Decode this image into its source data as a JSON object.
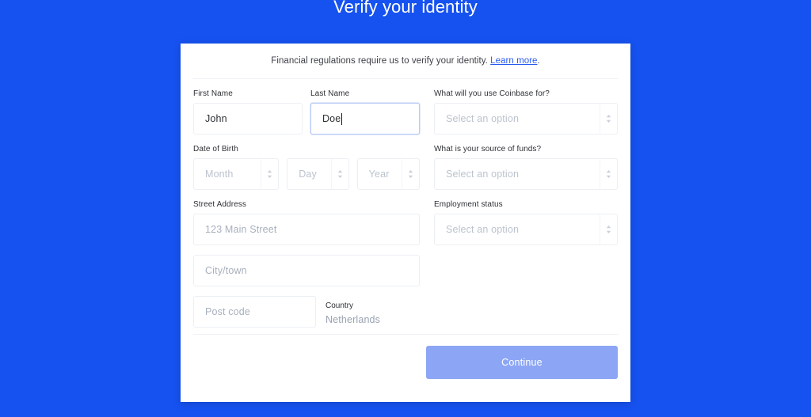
{
  "page": {
    "title": "Verify your identity",
    "background_color": "#1652f0"
  },
  "card": {
    "intro_text": "Financial regulations require us to verify your identity.",
    "intro_link_label": "Learn more",
    "intro_trailing": "."
  },
  "form": {
    "first_name": {
      "label": "First Name",
      "value": "John",
      "placeholder": ""
    },
    "last_name": {
      "label": "Last Name",
      "value": "Doe",
      "placeholder": "",
      "focused": true
    },
    "date_of_birth": {
      "label": "Date of Birth",
      "month_placeholder": "Month",
      "day_placeholder": "Day",
      "year_placeholder": "Year"
    },
    "street_address": {
      "label": "Street Address",
      "placeholder": "123 Main Street",
      "value": ""
    },
    "city": {
      "placeholder": "City/town",
      "value": ""
    },
    "post_code": {
      "placeholder": "Post code",
      "value": ""
    },
    "country": {
      "label": "Country",
      "value": "Netherlands"
    },
    "use_case": {
      "label": "What will you use Coinbase for?",
      "placeholder": "Select an option"
    },
    "source_of_funds": {
      "label": "What is your source of funds?",
      "placeholder": "Select an option"
    },
    "employment_status": {
      "label": "Employment status",
      "placeholder": "Select an option"
    }
  },
  "footer": {
    "continue_label": "Continue",
    "continue_color": "#8ca6f5"
  }
}
